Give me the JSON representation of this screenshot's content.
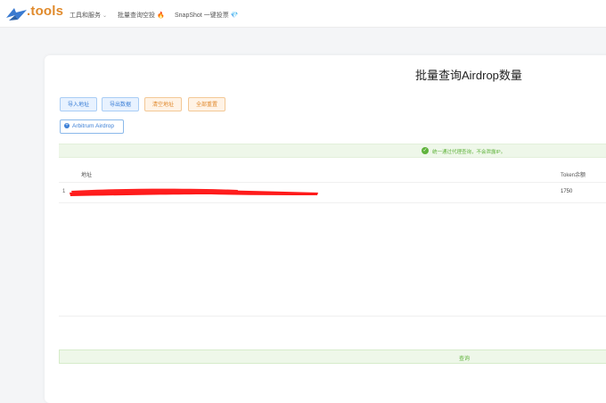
{
  "header": {
    "logo_text": ".tools",
    "nav": [
      {
        "label": "工具和服务",
        "suffix": "⌄"
      },
      {
        "label": "批量查询空投",
        "suffix": "🔥"
      },
      {
        "label": "SnapShot 一键投票",
        "suffix": "💎"
      }
    ]
  },
  "page": {
    "title": "批量查询Airdrop数量",
    "buttons": {
      "import": "导入地址",
      "export": "导出数据",
      "clear": "清空地址",
      "reset": "全部重置"
    },
    "airdrop_chip": "Arbitrum Airdrop",
    "notice": "统一通过代理查询，不会泄露IP。",
    "table": {
      "columns": [
        "地址",
        "Token余额"
      ],
      "rows": [
        {
          "index": "1",
          "address": "",
          "balance": "1750"
        }
      ]
    },
    "query_button": "查询"
  },
  "colors": {
    "accent_blue": "#3b7fd6",
    "accent_orange": "#e0892e",
    "success_green": "#5fb33b",
    "redaction": "#ff1a1a"
  }
}
